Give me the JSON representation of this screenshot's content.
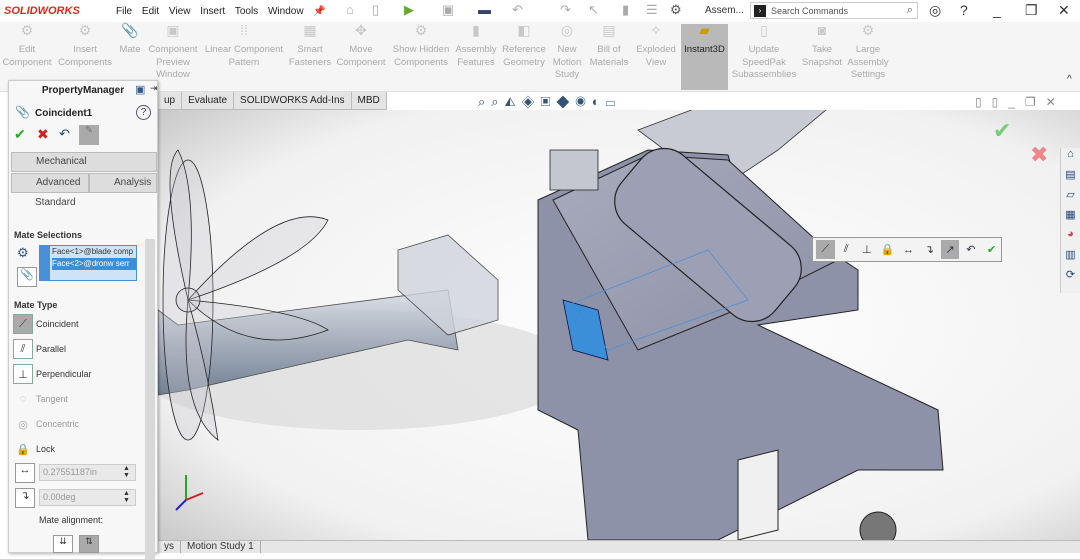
{
  "app": {
    "brand": "SOLIDWORKS",
    "menu": [
      "File",
      "Edit",
      "View",
      "Insert",
      "Tools",
      "Window"
    ],
    "doc_title": "Assem...",
    "search_placeholder": "Search Commands"
  },
  "ribbon": [
    {
      "label": "Edit Component"
    },
    {
      "label": "Insert Components"
    },
    {
      "label": "Mate"
    },
    {
      "label": "Component Preview Window"
    },
    {
      "label": "Linear Component Pattern"
    },
    {
      "label": "Smart Fasteners"
    },
    {
      "label": "Move Component"
    },
    {
      "label": "Show Hidden Components"
    },
    {
      "label": "Assembly Features"
    },
    {
      "label": "Reference Geometry"
    },
    {
      "label": "New Motion Study"
    },
    {
      "label": "Bill of Materials"
    },
    {
      "label": "Exploded View"
    },
    {
      "label": "Instant3D",
      "active": true
    },
    {
      "label": "Update SpeedPak Subassemblies"
    },
    {
      "label": "Take Snapshot"
    },
    {
      "label": "Large Assembly Settings"
    }
  ],
  "tabs": [
    "up",
    "Evaluate",
    "SOLIDWORKS Add-Ins",
    "MBD"
  ],
  "property_manager": {
    "title": "PropertyManager",
    "feature": "Coincident1",
    "tabs": [
      "Mechanical",
      "Advanced",
      "Analysis",
      "Standard"
    ],
    "mate_selections_label": "Mate Selections",
    "selections": [
      "Face<1>@blade comp",
      "Face<2>@dronw serr"
    ],
    "mate_type_label": "Mate Type",
    "mate_types": [
      {
        "label": "Coincident",
        "icon": "coincident-icon",
        "selected": true
      },
      {
        "label": "Parallel",
        "icon": "parallel-icon"
      },
      {
        "label": "Perpendicular",
        "icon": "perpendicular-icon"
      },
      {
        "label": "Tangent",
        "icon": "tangent-icon",
        "disabled": true
      },
      {
        "label": "Concentric",
        "icon": "concentric-icon",
        "disabled": true
      },
      {
        "label": "Lock",
        "icon": "lock-icon"
      }
    ],
    "distance": "0.27551187in",
    "angle": "0.00deg",
    "alignment_label": "Mate alignment:"
  },
  "bottom_tabs": [
    "ys",
    "Motion Study 1"
  ],
  "colors": {
    "accent": "#3a8fd8",
    "brand": "#d52b1e",
    "selection": "#4a90d9"
  }
}
